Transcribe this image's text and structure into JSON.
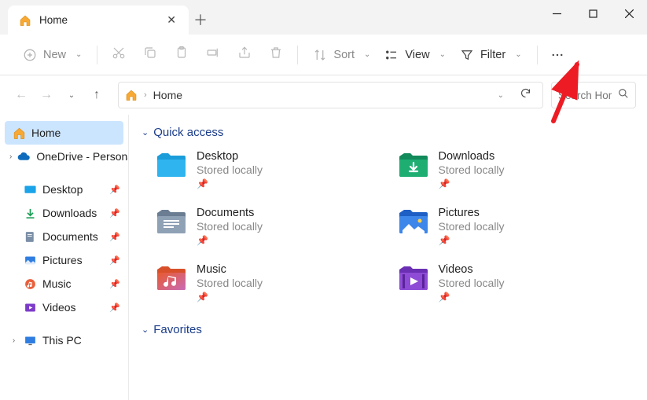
{
  "tab": {
    "title": "Home"
  },
  "toolbar": {
    "new": "New",
    "sort": "Sort",
    "view": "View",
    "filter": "Filter"
  },
  "address": {
    "crumb": "Home"
  },
  "search": {
    "placeholder": "Search Home"
  },
  "sidebar": {
    "home": "Home",
    "onedrive": "OneDrive - Personal",
    "desktop": "Desktop",
    "downloads": "Downloads",
    "documents": "Documents",
    "pictures": "Pictures",
    "music": "Music",
    "videos": "Videos",
    "thispc": "This PC"
  },
  "sections": {
    "quick": "Quick access",
    "favs": "Favorites"
  },
  "folders": [
    {
      "name": "Desktop",
      "loc": "Stored locally"
    },
    {
      "name": "Downloads",
      "loc": "Stored locally"
    },
    {
      "name": "Documents",
      "loc": "Stored locally"
    },
    {
      "name": "Pictures",
      "loc": "Stored locally"
    },
    {
      "name": "Music",
      "loc": "Stored locally"
    },
    {
      "name": "Videos",
      "loc": "Stored locally"
    }
  ]
}
